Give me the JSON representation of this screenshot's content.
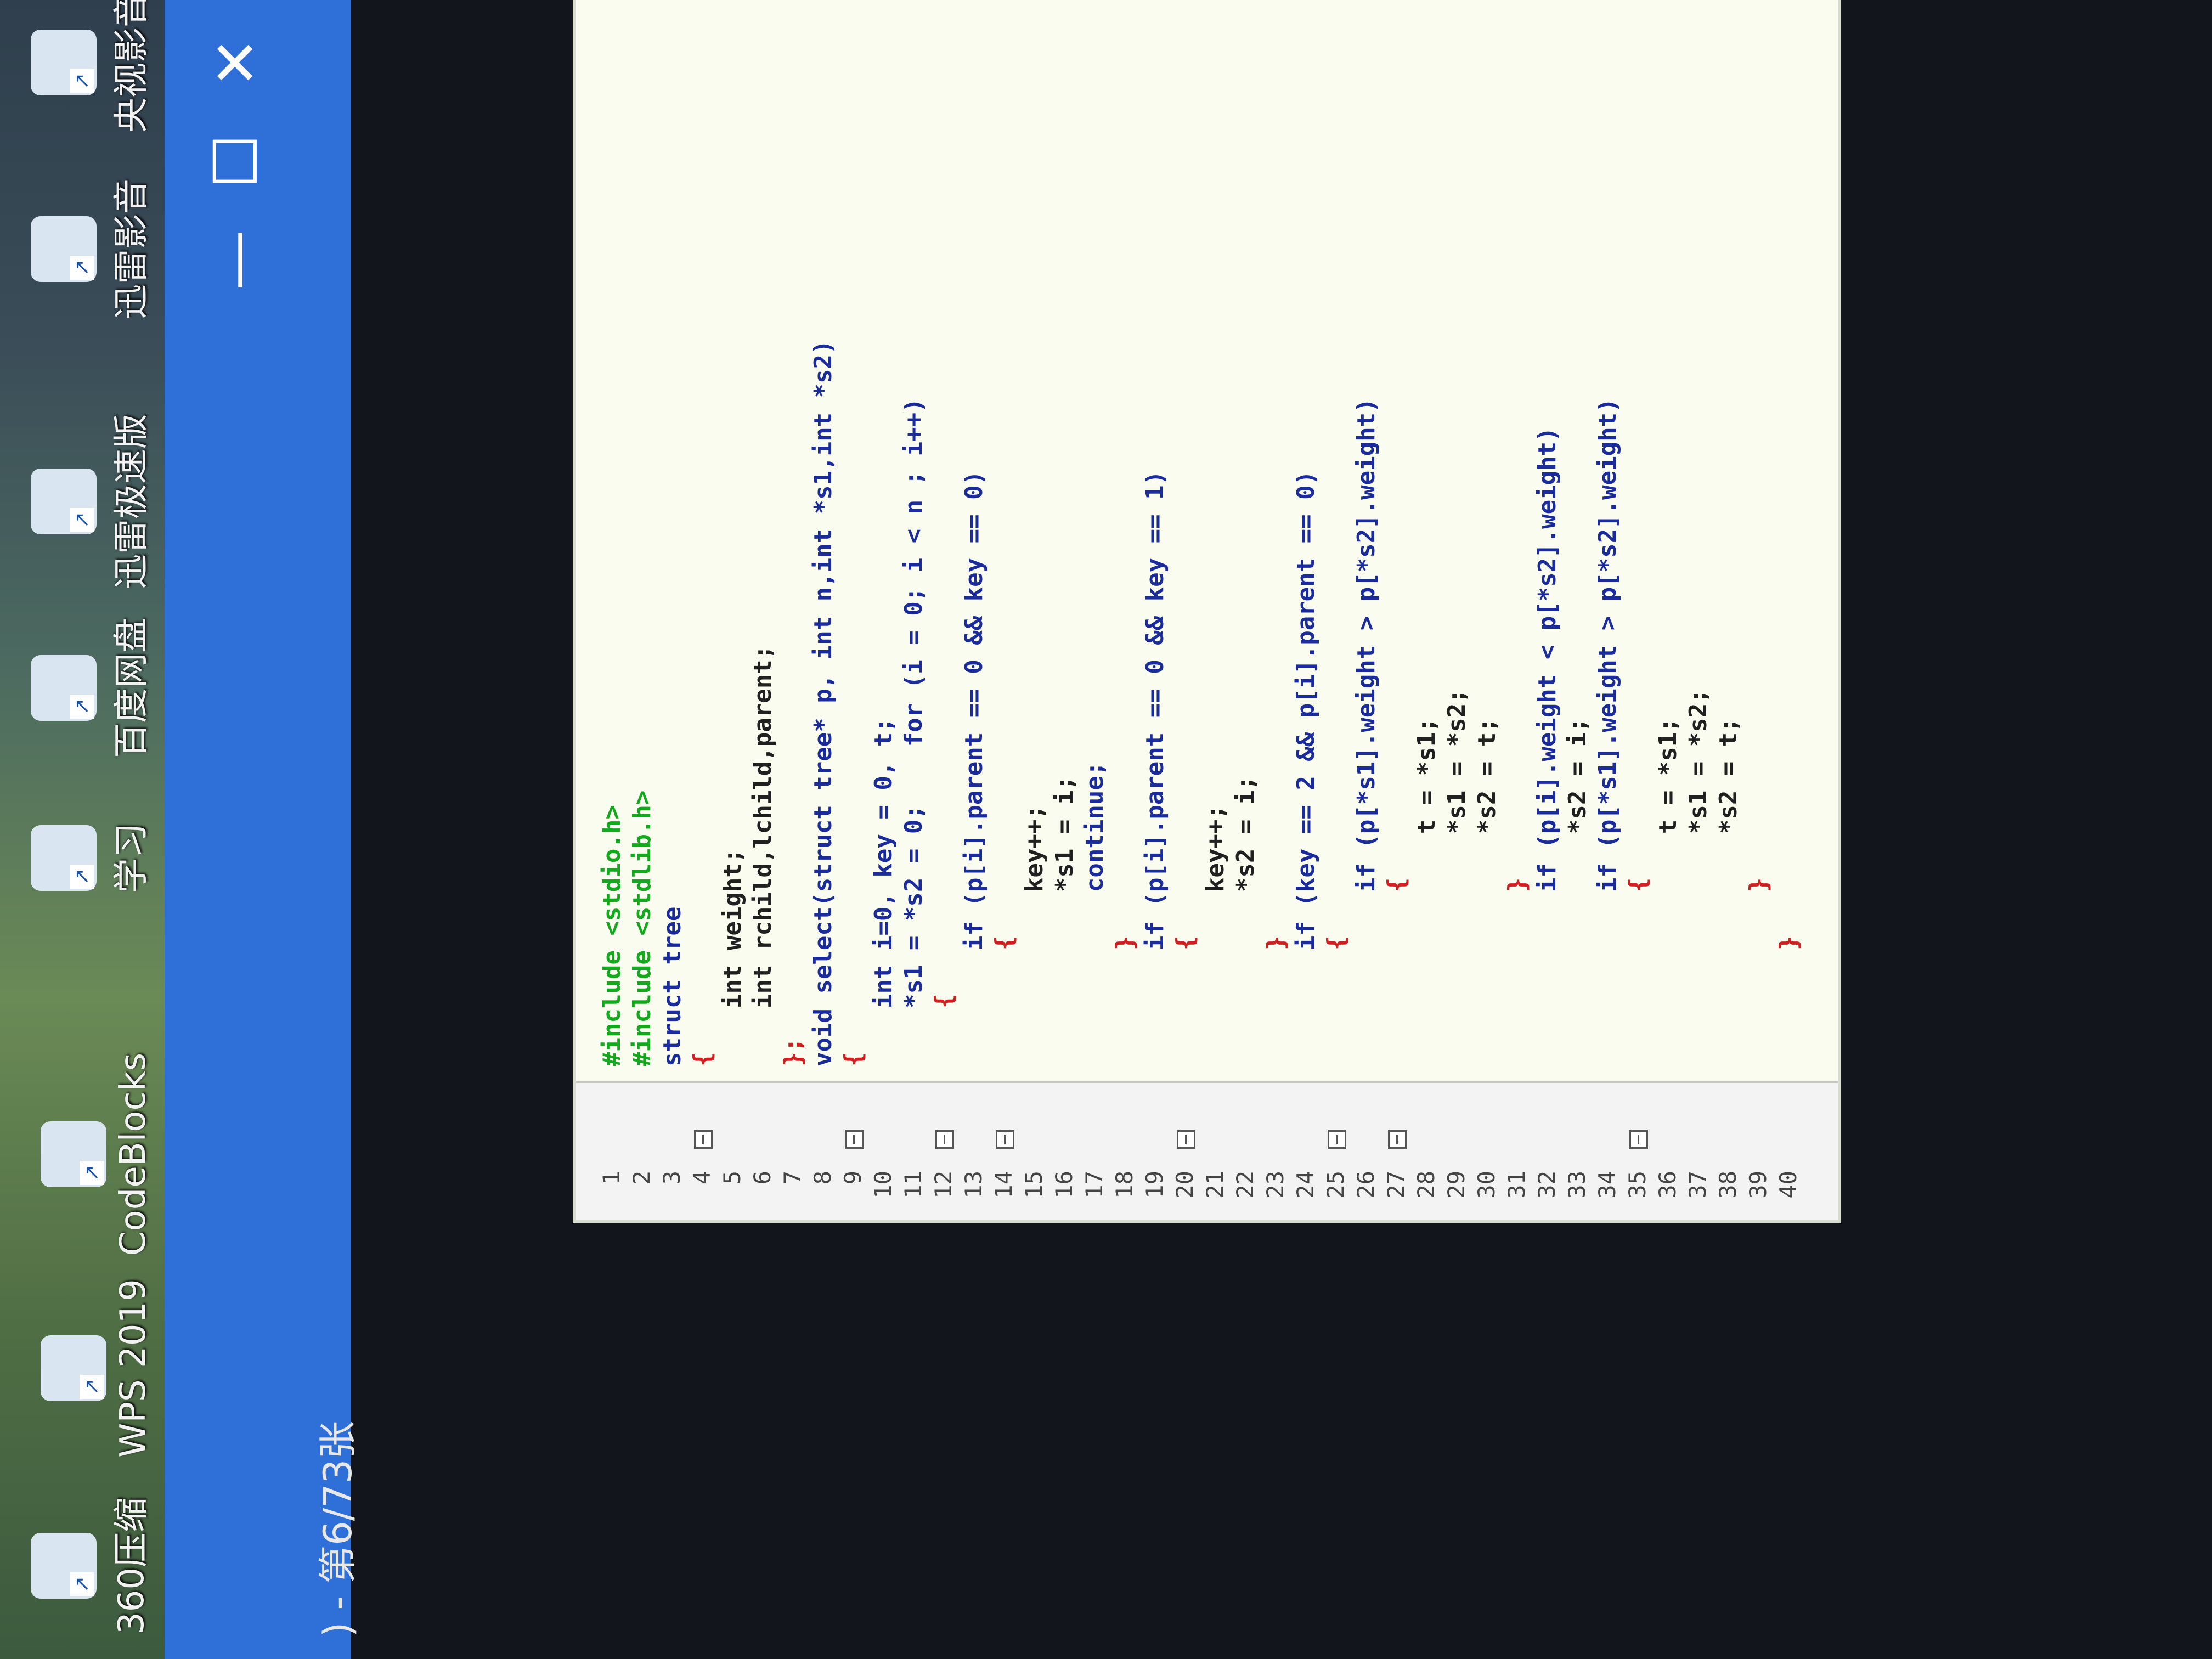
{
  "desktop": {
    "icons": [
      {
        "label": "360压缩"
      },
      {
        "label": "WPS 2019"
      },
      {
        "label": "CodeBlocks"
      },
      {
        "label": "学习"
      },
      {
        "label": "百度网盘"
      },
      {
        "label": "迅雷极速版"
      },
      {
        "label": "迅雷影音"
      },
      {
        "label": "央视影音"
      }
    ]
  },
  "window": {
    "minimize": "—",
    "maximize": "☐",
    "close": "✕",
    "page_counter": ") - 第6/73张"
  },
  "code": {
    "lines": [
      {
        "n": "1",
        "text": "#include <stdio.h>",
        "color": "#14a81c"
      },
      {
        "n": "2",
        "text": "#include <stdlib.h>",
        "color": "#14a81c"
      },
      {
        "n": "3",
        "text": "struct tree",
        "color": "#1a2b9c"
      },
      {
        "n": "4",
        "text": "{",
        "color": "#d21e1e"
      },
      {
        "n": "5",
        "text": "    int weight;",
        "color": "#202020"
      },
      {
        "n": "6",
        "text": "    int rchild,lchild,parent;",
        "color": "#202020"
      },
      {
        "n": "7",
        "text": "};",
        "color": "#d21e1e"
      },
      {
        "n": "8",
        "text": "void select(struct tree* p, int n,int *s1,int *s2)",
        "color": "#1a2b9c"
      },
      {
        "n": "9",
        "text": "{",
        "color": "#d21e1e"
      },
      {
        "n": "10",
        "text": "    int i=0, key = 0, t;",
        "color": "#1a2b9c"
      },
      {
        "n": "11",
        "text": "    *s1 = *s2 = 0;    for (i = 0; i < n ; i++)",
        "color": "#1a2b9c"
      },
      {
        "n": "12",
        "text": "    {",
        "color": "#d21e1e"
      },
      {
        "n": "13",
        "text": "        if (p[i].parent == 0 && key == 0)",
        "color": "#1a2b9c"
      },
      {
        "n": "14",
        "text": "        {",
        "color": "#d21e1e"
      },
      {
        "n": "15",
        "text": "            key++;",
        "color": "#202020"
      },
      {
        "n": "16",
        "text": "            *s1 = i;",
        "color": "#202020"
      },
      {
        "n": "17",
        "text": "            continue;",
        "color": "#1a2b9c"
      },
      {
        "n": "18",
        "text": "        }",
        "color": "#d21e1e"
      },
      {
        "n": "19",
        "text": "        if (p[i].parent == 0 && key == 1)",
        "color": "#1a2b9c"
      },
      {
        "n": "20",
        "text": "        {",
        "color": "#d21e1e"
      },
      {
        "n": "21",
        "text": "            key++;",
        "color": "#202020"
      },
      {
        "n": "22",
        "text": "            *s2 = i;",
        "color": "#202020"
      },
      {
        "n": "23",
        "text": "        }",
        "color": "#d21e1e"
      },
      {
        "n": "24",
        "text": "        if (key == 2 && p[i].parent == 0)",
        "color": "#1a2b9c"
      },
      {
        "n": "25",
        "text": "        {",
        "color": "#d21e1e"
      },
      {
        "n": "26",
        "text": "            if (p[*s1].weight > p[*s2].weight)",
        "color": "#1a2b9c"
      },
      {
        "n": "27",
        "text": "            {",
        "color": "#d21e1e"
      },
      {
        "n": "28",
        "text": "                t = *s1;",
        "color": "#202020"
      },
      {
        "n": "29",
        "text": "                *s1 = *s2;",
        "color": "#202020"
      },
      {
        "n": "30",
        "text": "                *s2 = t;",
        "color": "#202020"
      },
      {
        "n": "31",
        "text": "            }",
        "color": "#d21e1e"
      },
      {
        "n": "32",
        "text": "            if (p[i].weight < p[*s2].weight)",
        "color": "#1a2b9c"
      },
      {
        "n": "33",
        "text": "                *s2 = i;",
        "color": "#202020"
      },
      {
        "n": "34",
        "text": "            if (p[*s1].weight > p[*s2].weight)",
        "color": "#1a2b9c"
      },
      {
        "n": "35",
        "text": "            {",
        "color": "#d21e1e"
      },
      {
        "n": "36",
        "text": "                t = *s1;",
        "color": "#202020"
      },
      {
        "n": "37",
        "text": "                *s1 = *s2;",
        "color": "#202020"
      },
      {
        "n": "38",
        "text": "                *s2 = t;",
        "color": "#202020"
      },
      {
        "n": "39",
        "text": "            }",
        "color": "#d21e1e"
      },
      {
        "n": "40",
        "text": "        }",
        "color": "#d21e1e"
      }
    ],
    "fold_lines": [
      "4",
      "9",
      "12",
      "14",
      "20",
      "25",
      "27",
      "35"
    ]
  }
}
